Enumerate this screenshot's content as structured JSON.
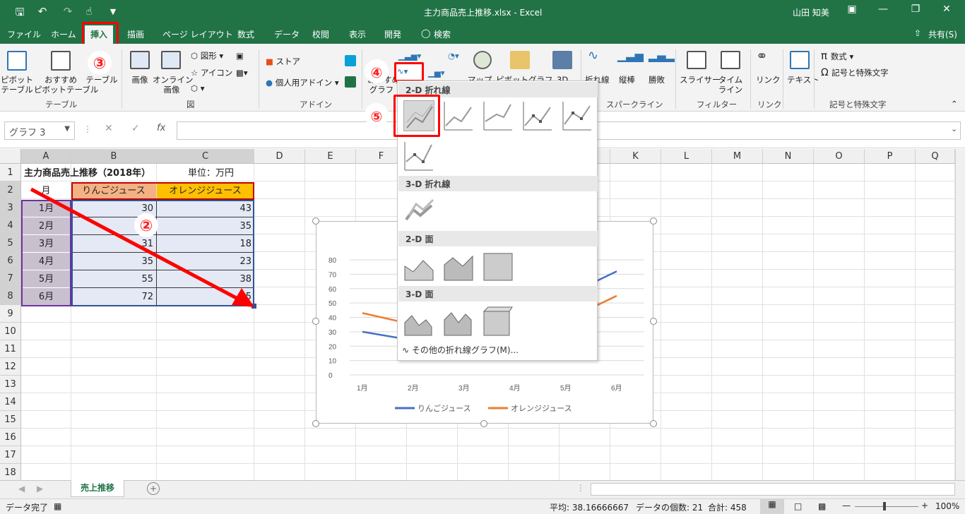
{
  "window": {
    "title": "主力商品売上推移.xlsx  -  Excel",
    "user": "山田 知美"
  },
  "tabs": [
    "ファイル",
    "ホーム",
    "挿入",
    "描画",
    "ページ レイアウト",
    "数式",
    "データ",
    "校閲",
    "表示",
    "開発"
  ],
  "tell_me": "検索",
  "share": "共有(S)",
  "ribbon": {
    "pivot": "ピボット\nテーブル",
    "rec_pivot": "おすすめ\nピボットテーブル",
    "table": "テーブル",
    "image": "画像",
    "online_image": "オンライン\n画像",
    "shapes": "図形",
    "icons": "アイコン",
    "store": "ストア",
    "my_addins": "個人用アドイン",
    "rec_chart": "おすすめ\nグラフ",
    "map": "マップ",
    "pivot_chart": "ピボットグラフ",
    "d3": "3D",
    "line": "折れ線",
    "column": "縦棒",
    "winloss": "勝敗",
    "slicer": "スライサー",
    "timeline": "タイム\nライン",
    "link": "リンク",
    "text": "テキスト",
    "equation": "数式",
    "symbol": "記号と特殊文字",
    "groups": {
      "table": "テーブル",
      "illust": "図",
      "addin": "アドイン",
      "spark": "スパークライン",
      "filter": "フィルター",
      "link": "リンク",
      "symbol": "記号と特殊文字"
    }
  },
  "namebox": "グラフ 3",
  "markers": {
    "m2": "②",
    "m3": "③",
    "m4": "④",
    "m5": "⑤"
  },
  "columns": [
    "A",
    "B",
    "C",
    "D",
    "E",
    "F",
    "G",
    "H",
    "I",
    "J",
    "K",
    "L",
    "M",
    "N",
    "O",
    "P",
    "Q"
  ],
  "rows": [
    "1",
    "2",
    "3",
    "4",
    "5",
    "6",
    "7",
    "8",
    "9",
    "10",
    "11",
    "12",
    "13",
    "14",
    "15",
    "16",
    "17",
    "18"
  ],
  "sheet": {
    "title": "主力商品売上推移（2018年）",
    "unit": "単位：万円",
    "headers": [
      "月",
      "りんごジュース",
      "オレンジジュース"
    ],
    "data": [
      [
        "1月",
        "30",
        "43"
      ],
      [
        "2月",
        "",
        "35"
      ],
      [
        "3月",
        "31",
        "18"
      ],
      [
        "4月",
        "35",
        "23"
      ],
      [
        "5月",
        "55",
        "38"
      ],
      [
        "6月",
        "72",
        "55"
      ]
    ]
  },
  "dropdown": {
    "h1": "2-D 折れ線",
    "h2": "3-D 折れ線",
    "h3": "2-D 面",
    "h4": "3-D 面",
    "more": "その他の折れ線グラフ(M)..."
  },
  "chart_data": {
    "type": "line",
    "categories": [
      "1月",
      "2月",
      "3月",
      "4月",
      "5月",
      "6月"
    ],
    "series": [
      {
        "name": "りんごジュース",
        "values": [
          30,
          24,
          31,
          35,
          55,
          72
        ],
        "color": "#4472c4"
      },
      {
        "name": "オレンジジュース",
        "values": [
          43,
          35,
          18,
          23,
          38,
          55
        ],
        "color": "#ed7d31"
      }
    ],
    "yticks": [
      "0",
      "10",
      "20",
      "30",
      "40",
      "50",
      "60",
      "70",
      "80"
    ],
    "ylim": [
      0,
      80
    ],
    "legend": "bottom"
  },
  "sheet_tab": "売上推移",
  "status": {
    "ready": "データ完了",
    "avg": "平均: 38.16666667",
    "count": "データの個数: 21",
    "sum": "合計: 458",
    "zoom": "100%"
  }
}
